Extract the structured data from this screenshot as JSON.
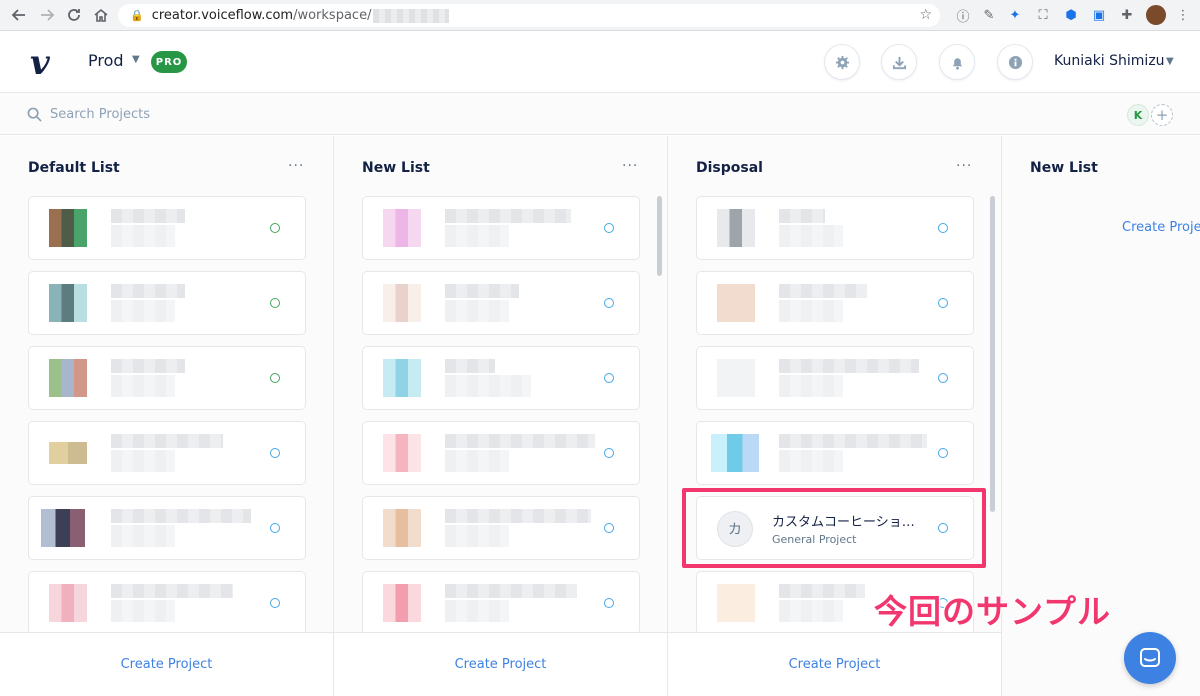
{
  "browser": {
    "url_host": "creator.voiceflow.com",
    "url_path": "/workspace/"
  },
  "header": {
    "logo": "v",
    "workspace": "Prod",
    "plan_badge": "PRO",
    "user_name": "Kuniaki Shimizu"
  },
  "search": {
    "placeholder": "Search Projects"
  },
  "members": {
    "initial": "K",
    "add": "+"
  },
  "columns": [
    {
      "title": "Default List",
      "menu": "···",
      "create": "Create Project"
    },
    {
      "title": "New List",
      "menu": "···",
      "create": "Create Project"
    },
    {
      "title": "Disposal",
      "menu": "···",
      "create": "Create Project"
    },
    {
      "title": "New List",
      "create": "Create Proje"
    }
  ],
  "sample_project": {
    "avatar": "カ",
    "title": "カスタムコーヒーショッ...",
    "subtitle": "General Project"
  },
  "annotation": {
    "callout": "今回のサンプル",
    "color": "#f2376f"
  },
  "colors": {
    "accent": "#3d82e2",
    "pro_green": "#279745",
    "status_live": "#42a65a",
    "status_idle": "#44a8e8"
  }
}
